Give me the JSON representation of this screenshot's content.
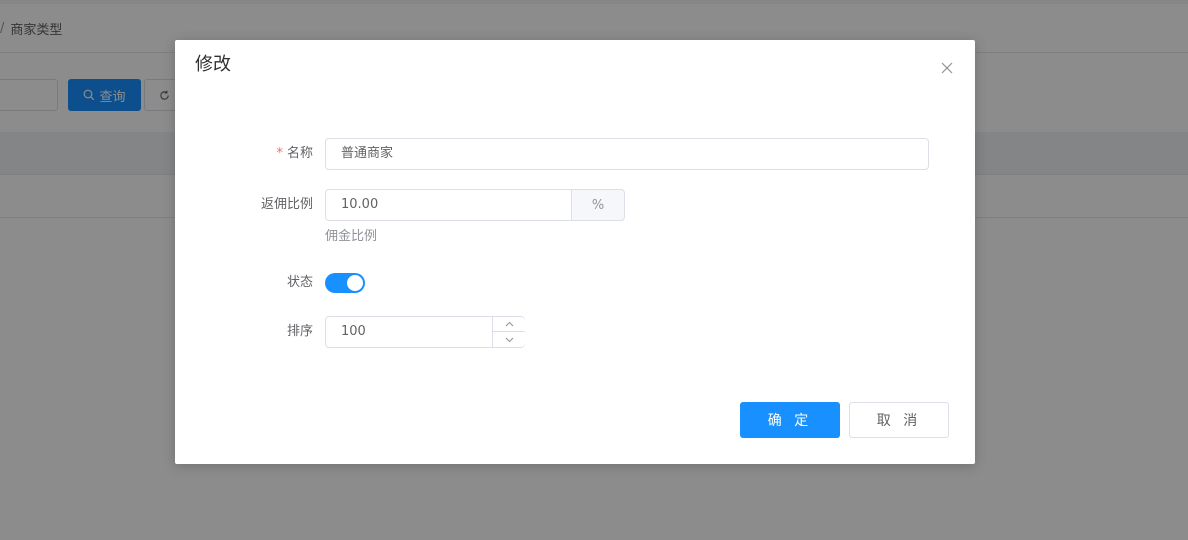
{
  "background": {
    "breadcrumb": {
      "separator": "/",
      "current": "商家类型"
    },
    "toolbar": {
      "query_label": "查询"
    }
  },
  "dialog": {
    "title": "修改",
    "form": {
      "name": {
        "label": "名称",
        "required_mark": "*",
        "value": "普通商家"
      },
      "rebate": {
        "label": "返佣比例",
        "value": "10.00",
        "unit": "%",
        "help": "佣金比例"
      },
      "status": {
        "label": "状态",
        "enabled": true
      },
      "sort": {
        "label": "排序",
        "value": "100"
      }
    },
    "buttons": {
      "confirm": "确 定",
      "cancel": "取 消"
    }
  },
  "colors": {
    "primary": "#1890ff",
    "required": "#f56c6c",
    "mask": "rgba(0,0,0,0.45)"
  }
}
